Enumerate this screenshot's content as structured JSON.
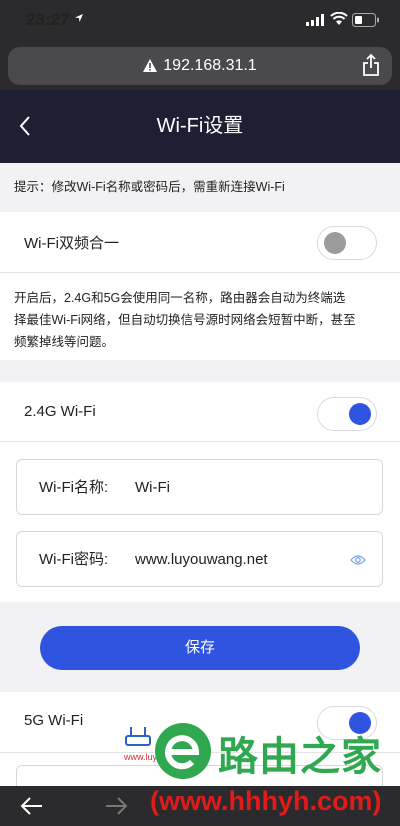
{
  "status_bar": {
    "time": "23:27"
  },
  "browser": {
    "url": "192.168.31.1"
  },
  "header": {
    "title": "Wi-Fi设置"
  },
  "tip": "提示：修改Wi-Fi名称或密码后，需重新连接Wi-Fi",
  "dual_band": {
    "label": "Wi-Fi双频合一",
    "enabled": false,
    "description_line1": "开启后，2.4G和5G会使用同一名称，路由器会自动为终端选",
    "description_line2": "择最佳Wi-Fi网络，但自动切换信号源时网络会短暂中断，甚至",
    "description_line3": "频繁掉线等问题。"
  },
  "wifi_24": {
    "label": "2.4G Wi-Fi",
    "enabled": true,
    "name_label": "Wi-Fi名称:",
    "name_value": "Wi-Fi",
    "password_label": "Wi-Fi密码:",
    "password_value": "www.luyouwang.net"
  },
  "save_label": "保存",
  "wifi_5": {
    "label": "5G Wi-Fi",
    "enabled": true
  },
  "watermark": {
    "brand": "路由之家",
    "url": "(www.hhhyh.com)",
    "small_text": "www.luyouqi.com"
  },
  "colors": {
    "accent": "#2f54e0",
    "header_bg": "#1f1f33",
    "watermark_green": "#2fa84f",
    "watermark_red": "#e11a1a"
  }
}
